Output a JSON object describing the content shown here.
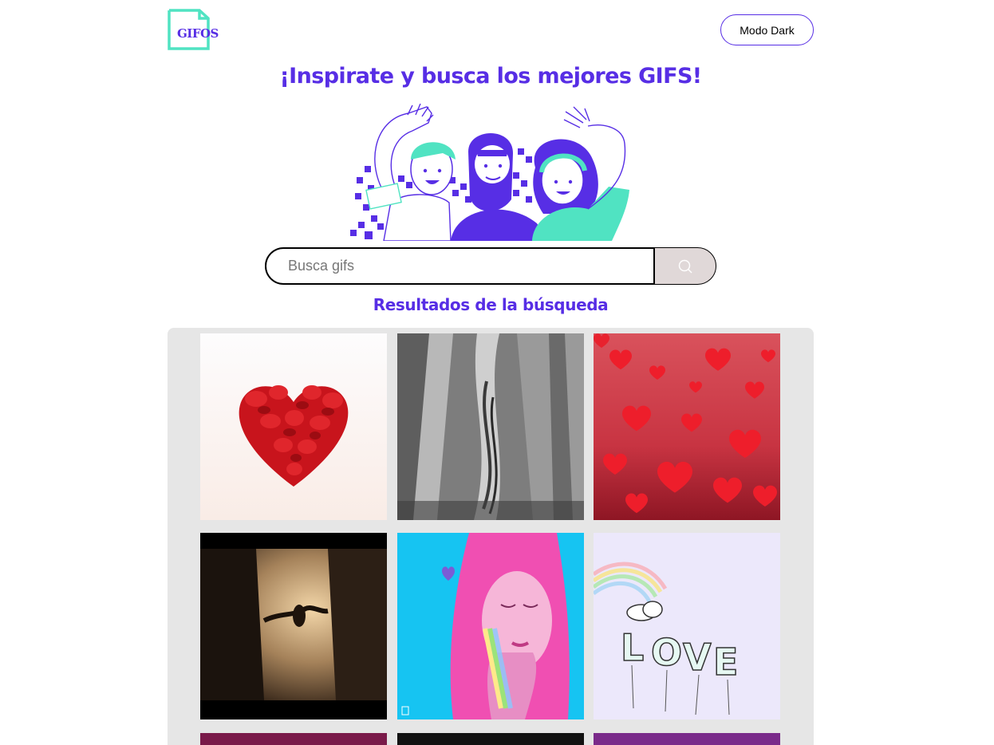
{
  "header": {
    "logo_text": "GIFOS",
    "mode_button_label": "Modo Dark"
  },
  "hero": {
    "headline": "¡Inspirate y busca los mejores GIFS!"
  },
  "search": {
    "placeholder": "Busca gifs",
    "value": ""
  },
  "results": {
    "title": "Resultados de la búsqueda",
    "gifs": [
      {
        "description": "heart of rose petals"
      },
      {
        "description": "hands intertwined black and white"
      },
      {
        "description": "falling red hearts"
      },
      {
        "description": "couple holding hands at sunset"
      },
      {
        "description": "pink-haired girl with rainbow"
      },
      {
        "description": "LOVE balloons with rainbow"
      }
    ]
  },
  "colors": {
    "brand": "#572ee5",
    "accent": "#50e3c2",
    "results_background": "#e6e6e6",
    "search_button": "#e0d8d8"
  }
}
